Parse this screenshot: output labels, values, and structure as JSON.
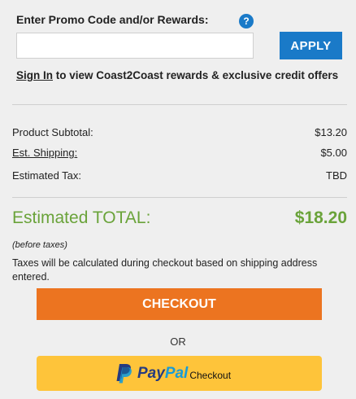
{
  "promo": {
    "label": "Enter Promo Code and/or Rewards:",
    "help_icon_glyph": "?",
    "input_value": "",
    "input_placeholder": "",
    "apply_label": "APPLY"
  },
  "signin": {
    "link_label": "Sign In",
    "rest_text": " to view Coast2Coast rewards & exclusive credit offers"
  },
  "summary": {
    "rows": [
      {
        "label": "Product Subtotal:",
        "value": "$13.20"
      },
      {
        "label": "Est. Shipping:",
        "value": "$5.00"
      },
      {
        "label": "Estimated Tax:",
        "value": "TBD"
      }
    ]
  },
  "total": {
    "label": "Estimated TOTAL:",
    "value": "$18.20",
    "before_taxes": "(before taxes)",
    "tax_note": "Taxes will be calculated during checkout based on shipping address entered."
  },
  "checkout": {
    "label": "CHECKOUT",
    "or_text": "OR"
  },
  "paypal": {
    "word_pay": "Pay",
    "word_pal": "Pal",
    "checkout_label": "Checkout"
  },
  "colors": {
    "accent_blue": "#1a7ac8",
    "total_green": "#6aa33a",
    "checkout_orange": "#ec7420",
    "paypal_yellow": "#fec43a",
    "paypal_dark_blue": "#253b80",
    "paypal_light_blue": "#179bd7",
    "background": "#efefef"
  }
}
